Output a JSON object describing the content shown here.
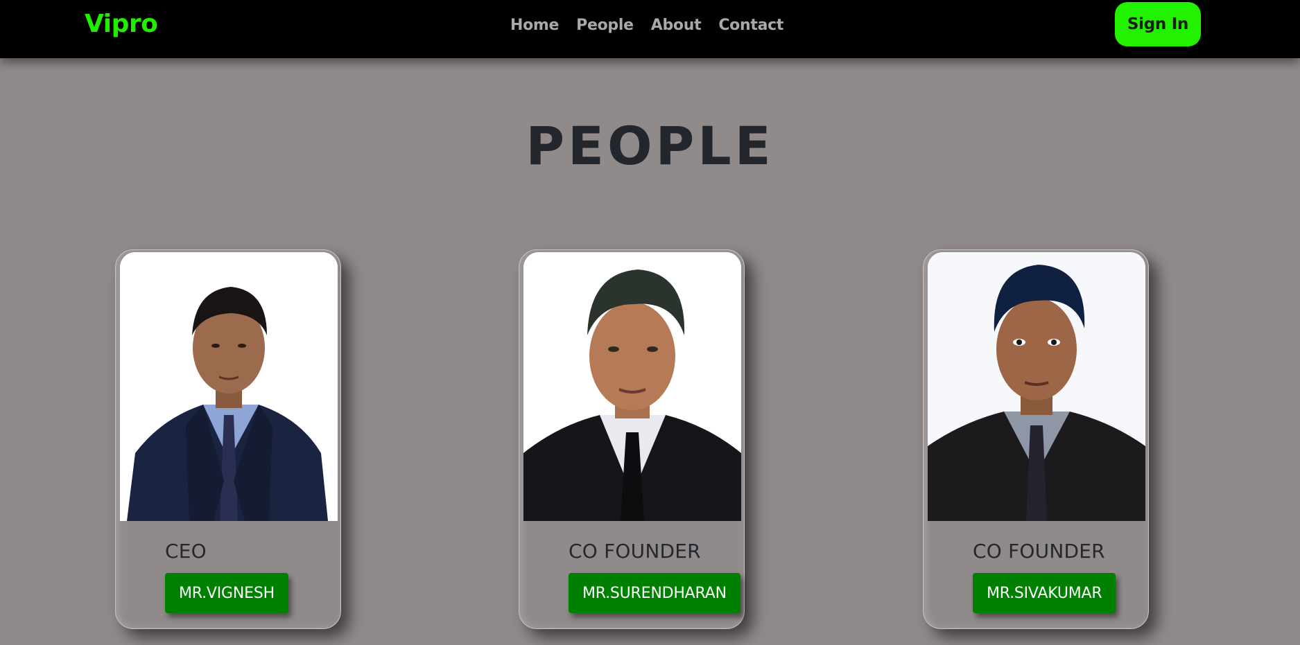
{
  "nav": {
    "brand": "Vipro",
    "links": [
      "Home",
      "People",
      "About",
      "Contact"
    ],
    "sign_in": "Sign In"
  },
  "page": {
    "heading": "PEOPLE"
  },
  "people": [
    {
      "role": "CEO",
      "name": "MR.VIGNESH"
    },
    {
      "role": "CO FOUNDER",
      "name": "MR.SURENDHARAN"
    },
    {
      "role": "CO FOUNDER",
      "name": "MR.SIVAKUMAR"
    }
  ],
  "colors": {
    "accent": "#22ee00",
    "name_button": "#008000",
    "background": "#918a8a",
    "navbar": "#000000"
  }
}
